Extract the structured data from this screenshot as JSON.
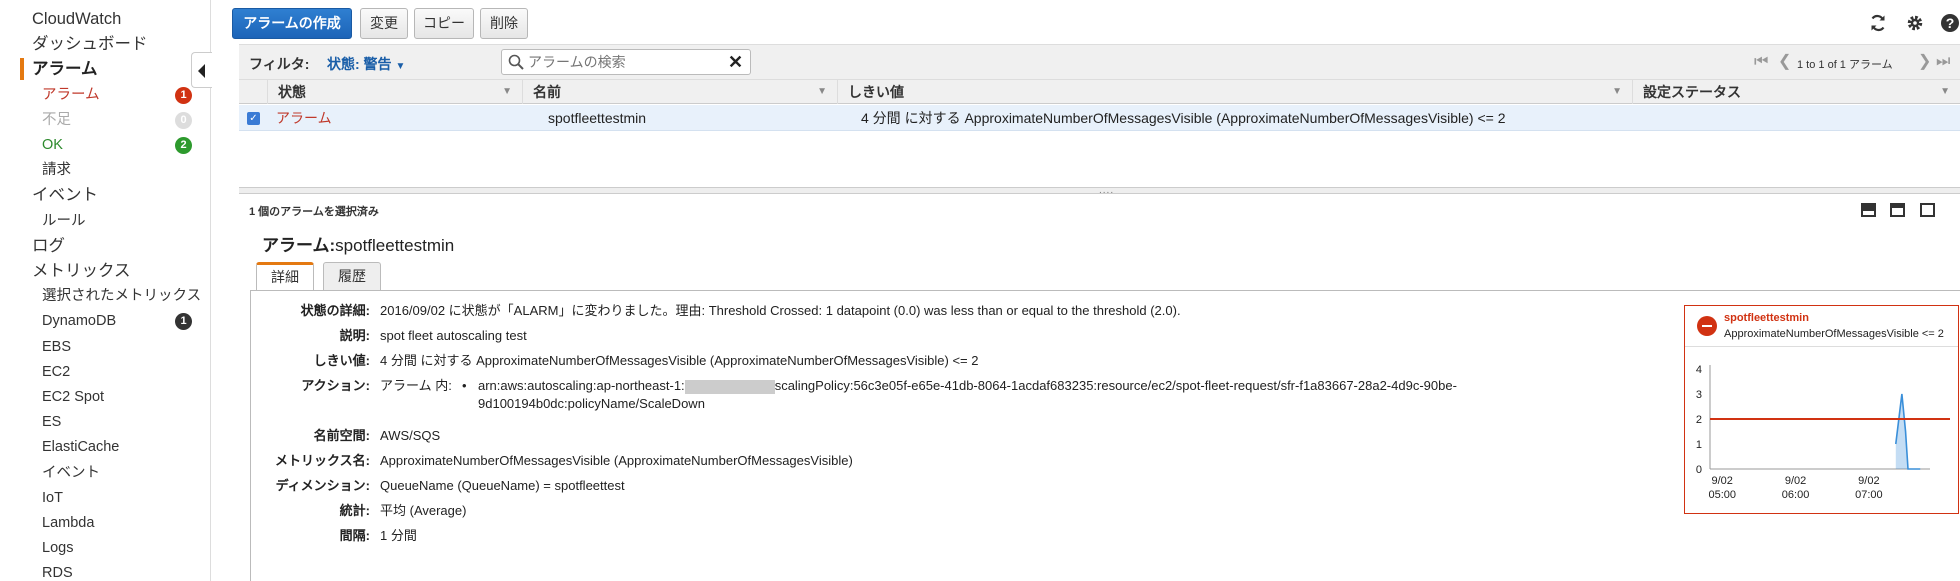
{
  "sidebar": {
    "items": [
      {
        "label": "CloudWatch",
        "level": "top"
      },
      {
        "label": "ダッシュボード",
        "level": "top"
      },
      {
        "label": "アラーム",
        "level": "top",
        "active": true
      },
      {
        "label": "アラーム",
        "level": "sub",
        "color": "#c0392b",
        "badge": "1",
        "badge_color": "#d13212"
      },
      {
        "label": "不足",
        "level": "sub",
        "color": "#aaaaaa",
        "badge": "0",
        "badge_color": "#dddddd"
      },
      {
        "label": "OK",
        "level": "sub",
        "color": "#2d8a2d",
        "badge": "2",
        "badge_color": "#2d9a2d"
      },
      {
        "label": "請求",
        "level": "sub"
      },
      {
        "label": "イベント",
        "level": "top"
      },
      {
        "label": "ルール",
        "level": "sub"
      },
      {
        "label": "ログ",
        "level": "top"
      },
      {
        "label": "メトリックス",
        "level": "top"
      },
      {
        "label": "選択されたメトリックス",
        "level": "sub"
      },
      {
        "label": "DynamoDB",
        "level": "sub",
        "badge": "1",
        "badge_color": "#333333"
      },
      {
        "label": "EBS",
        "level": "sub"
      },
      {
        "label": "EC2",
        "level": "sub"
      },
      {
        "label": "EC2 Spot",
        "level": "sub"
      },
      {
        "label": "ES",
        "level": "sub"
      },
      {
        "label": "ElastiCache",
        "level": "sub"
      },
      {
        "label": "イベント",
        "level": "sub"
      },
      {
        "label": "IoT",
        "level": "sub"
      },
      {
        "label": "Lambda",
        "level": "sub"
      },
      {
        "label": "Logs",
        "level": "sub"
      },
      {
        "label": "RDS",
        "level": "sub"
      }
    ]
  },
  "toolbar": {
    "create_label": "アラームの作成",
    "modify_label": "変更",
    "copy_label": "コピー",
    "delete_label": "削除"
  },
  "filter": {
    "label": "フィルタ:",
    "value": "状態: 警告",
    "search_placeholder": "アラームの検索",
    "pager_text": "1 to 1 of 1 アラーム"
  },
  "table": {
    "columns": [
      "状態",
      "名前",
      "しきい値",
      "設定ステータス"
    ],
    "rows": [
      {
        "state": "アラーム",
        "name": "spotfleettestmin",
        "threshold": "4 分間 に対する ApproximateNumberOfMessagesVisible (ApproximateNumberOfMessagesVisible) <= 2",
        "config_status": ""
      }
    ]
  },
  "detail": {
    "selected_count": "1 個のアラームを選択済み",
    "title_prefix": "アラーム:",
    "title_name": "spotfleettestmin",
    "tabs": [
      "詳細",
      "履歴"
    ],
    "fields": {
      "state_label": "状態の詳細:",
      "state_value": "2016/09/02 に状態が「ALARM」に変わりました。理由: Threshold Crossed: 1 datapoint (0.0) was less than or equal to the threshold (2.0).",
      "desc_label": "説明:",
      "desc_value": "spot fleet autoscaling test",
      "threshold_label": "しきい値:",
      "threshold_value": "4 分間 に対する ApproximateNumberOfMessagesVisible (ApproximateNumberOfMessagesVisible) <= 2",
      "action_label": "アクション:",
      "action_prefix": "アラーム 内:",
      "action_arn_a": "arn:aws:autoscaling:ap-northeast-1:",
      "action_arn_b": "scalingPolicy:56c3e05f-e65e-41db-8064-1acdaf683235:resource/ec2/spot-fleet-request/sfr-f1a83667-28a2-4d9c-90be-",
      "action_arn_c": "9d100194b0dc:policyName/ScaleDown",
      "namespace_label": "名前空間:",
      "namespace_value": "AWS/SQS",
      "metric_label": "メトリックス名:",
      "metric_value": "ApproximateNumberOfMessagesVisible (ApproximateNumberOfMessagesVisible)",
      "dimension_label": "ディメンション:",
      "dimension_value": "QueueName (QueueName) = spotfleettest",
      "stat_label": "統計:",
      "stat_value": "平均 (Average)",
      "period_label": "間隔:",
      "period_value": "1 分間"
    }
  },
  "graph": {
    "title": "spotfleettestmin",
    "subtitle": "ApproximateNumberOfMessagesVisible <= 2",
    "threshold_color": "#d13212",
    "series_color": "#3a8fd9"
  },
  "chart_data": {
    "type": "area",
    "title": "spotfleettestmin",
    "subtitle": "ApproximateNumberOfMessagesVisible <= 2",
    "ylim": [
      0,
      4
    ],
    "yticks": [
      0,
      1,
      2,
      3,
      4
    ],
    "xticks": [
      {
        "t": 300,
        "date": "9/02",
        "time": "05:00"
      },
      {
        "t": 360,
        "date": "9/02",
        "time": "06:00"
      },
      {
        "t": 420,
        "date": "9/02",
        "time": "07:00"
      }
    ],
    "xlim": [
      290,
      470
    ],
    "threshold": 2,
    "series": [
      {
        "values": [
          [
            442,
            1.0
          ],
          [
            447,
            3.0
          ],
          [
            450,
            1.5
          ],
          [
            452,
            0.0
          ],
          [
            462,
            0.0
          ]
        ]
      }
    ]
  }
}
